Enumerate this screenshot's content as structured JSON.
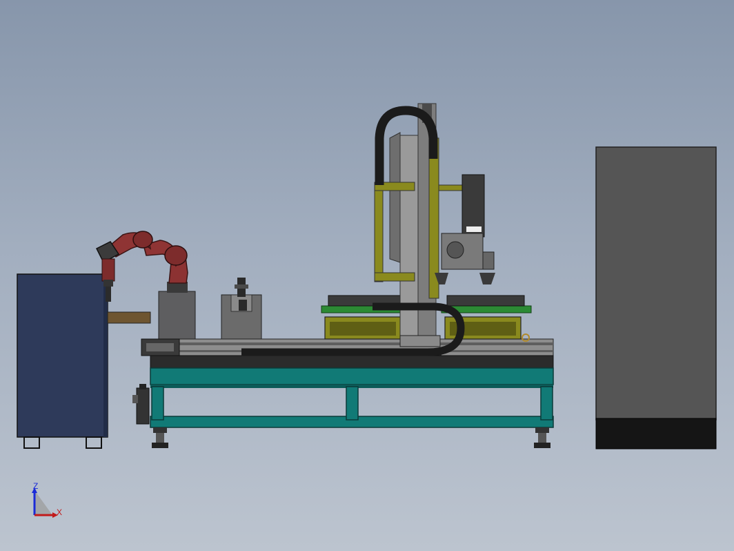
{
  "triad": {
    "z_label": "Z",
    "x_label": "X",
    "z_color": "#1a2ad8",
    "x_color": "#c21a1a"
  },
  "colors": {
    "background_top": "#8796ab",
    "background_bottom": "#bcc4cf",
    "frame_teal": "#117a76",
    "cabinet_navy": "#2e3a5a",
    "enclosure_gray": "#555555",
    "robot_red": "#8c3232",
    "gantry_olive": "#8a8a1e",
    "fixture_green": "#2c8a34",
    "cable_chain": "#1b1b1b"
  }
}
